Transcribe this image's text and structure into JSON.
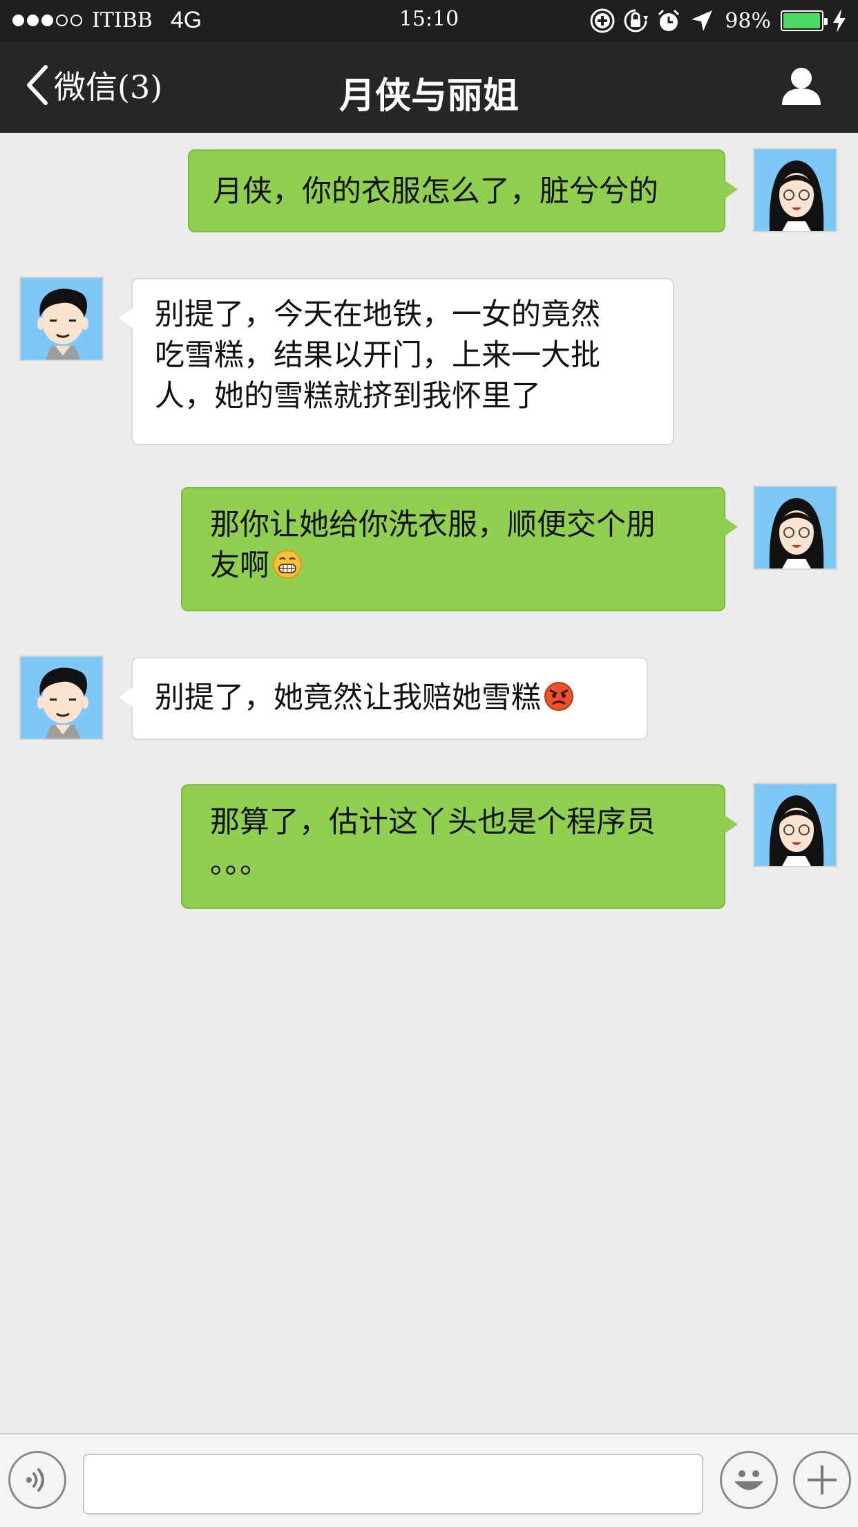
{
  "status_bar": {
    "signal_dots": [
      true,
      true,
      true,
      false,
      false
    ],
    "carrier": "ITIBB",
    "network": "4G",
    "time": "15:10",
    "battery_percent": "98%",
    "battery_level": 0.98,
    "icons": [
      "rotation-lock-plus-icon",
      "orientation-lock-icon",
      "alarm-icon",
      "location-arrow-icon",
      "charging-bolt-icon"
    ],
    "battery_color": "#4cd964"
  },
  "nav": {
    "back_label": "微信(3)",
    "title": "月侠与丽姐",
    "profile_icon": "person-icon"
  },
  "messages": [
    {
      "side": "out",
      "sender": "female",
      "lines": [
        "月侠，你的衣服怎么了，脏兮兮的"
      ],
      "emoji": ""
    },
    {
      "side": "in",
      "sender": "male",
      "lines": [
        "别提了，今天在地铁，一女的竟然",
        "吃雪糕，结果以开门，上来一大批",
        "人，她的雪糕就挤到我怀里了"
      ],
      "emoji": ""
    },
    {
      "side": "out",
      "sender": "female",
      "lines": [
        "那你让她给你洗衣服，顺便交个朋",
        "友啊"
      ],
      "emoji": "grin-emoji"
    },
    {
      "side": "in",
      "sender": "male",
      "lines": [
        "别提了，她竟然让我赔她雪糕"
      ],
      "emoji": "angry-emoji"
    },
    {
      "side": "out",
      "sender": "female",
      "lines": [
        "那算了，估计这丫头也是个程序员",
        "。。。"
      ],
      "emoji": ""
    }
  ],
  "input_bar": {
    "voice_icon": "voice-icon",
    "text_value": "",
    "emoji_icon": "smiley-icon",
    "more_icon": "plus-icon"
  },
  "colors": {
    "nav_bg": "#262626",
    "chat_bg": "#ebebeb",
    "outgoing_bubble": "#91cf50",
    "incoming_bubble": "#ffffff",
    "avatar_bg": "#7ec8f7"
  }
}
